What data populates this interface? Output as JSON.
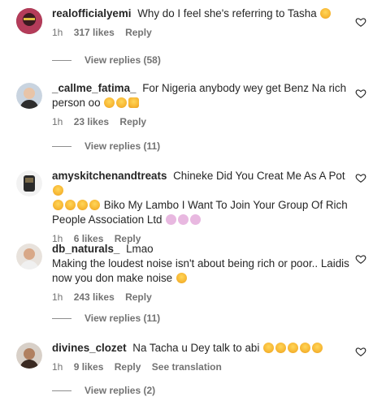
{
  "comments": [
    {
      "username": "realofficialyemi",
      "text": "Why do I feel she's referring to Tasha",
      "emojis": 1,
      "time": "1h",
      "likes": "317 likes",
      "reply": "Reply",
      "view_replies": "View replies (58)"
    },
    {
      "username": "_callme_fatima_",
      "text": "For Nigeria anybody wey get Benz Na rich person oo",
      "time": "1h",
      "likes": "23 likes",
      "reply": "Reply",
      "view_replies": "View replies (11)"
    },
    {
      "username": "amyskitchenandtreats",
      "text": "Chineke Did You Creat Me As A Pot",
      "text2": "Biko My Lambo I Want To Join Your Group Of Rich People Association Ltd",
      "time": "1h",
      "likes": "6 likes",
      "reply": "Reply"
    },
    {
      "username": "db_naturals_",
      "text": "Lmao",
      "text2": "Making the loudest noise isn't about being rich or poor.. Laidis now you don make noise",
      "time": "1h",
      "likes": "243 likes",
      "reply": "Reply",
      "view_replies": "View replies (11)"
    },
    {
      "username": "divines_clozet",
      "text": "Na Tacha u Dey talk to abi",
      "time": "1h",
      "likes": "9 likes",
      "reply": "Reply",
      "see_translation": "See translation",
      "view_replies": "View replies (2)"
    }
  ],
  "colors": {
    "text": "#262626",
    "secondary": "#737373",
    "emoji": "#f7b733"
  }
}
